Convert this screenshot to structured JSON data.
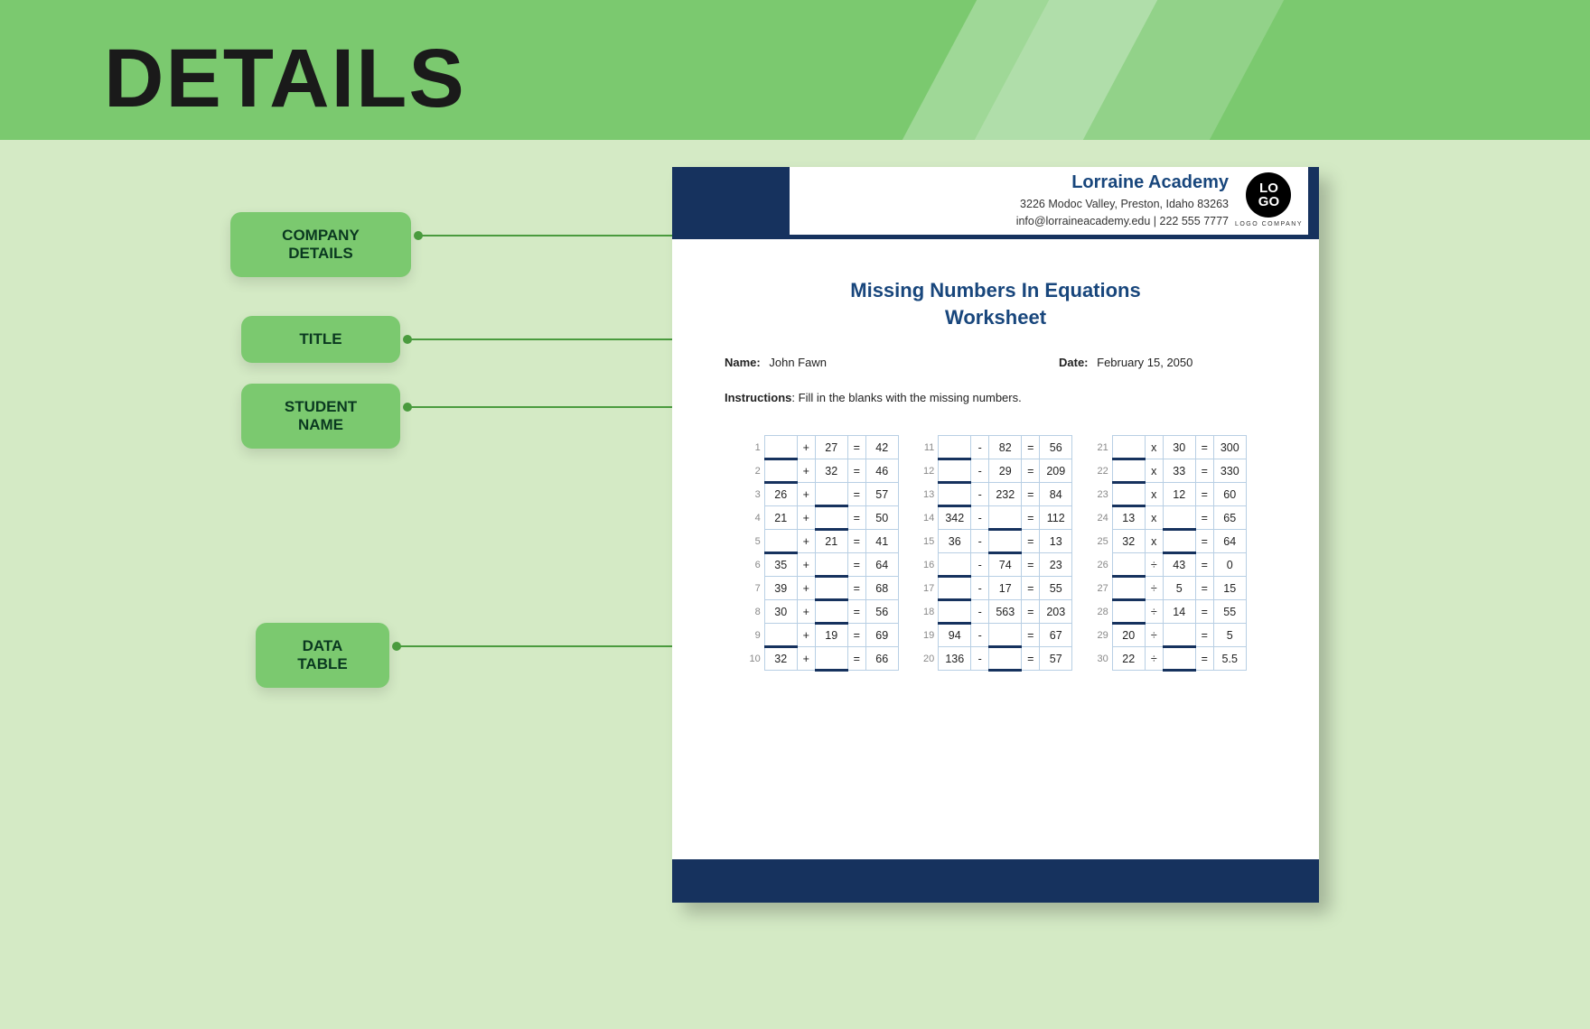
{
  "banner": {
    "title": "DETAILS"
  },
  "labels": {
    "company": "COMPANY DETAILS",
    "title": "TITLE",
    "student": "STUDENT NAME",
    "data": "DATA TABLE"
  },
  "doc": {
    "company": {
      "name": "Lorraine Academy",
      "address": "3226 Modoc Valley, Preston, Idaho 83263",
      "contact": "info@lorraineacademy.edu | 222 555 7777"
    },
    "logo": {
      "line1": "LO",
      "line2": "GO",
      "sub": "LOGO COMPANY"
    },
    "title": "Missing Numbers In Equations Worksheet",
    "meta": {
      "name_label": "Name:",
      "name_value": "John Fawn",
      "date_label": "Date:",
      "date_value": "February 15, 2050"
    },
    "instructions_label": "Instructions",
    "instructions_text": ": Fill in the blanks with the missing numbers.",
    "tables": [
      {
        "start": 1,
        "rows": [
          {
            "a": "",
            "op": "+",
            "b": "27",
            "r": "42"
          },
          {
            "a": "",
            "op": "+",
            "b": "32",
            "r": "46"
          },
          {
            "a": "26",
            "op": "+",
            "b": "",
            "r": "57"
          },
          {
            "a": "21",
            "op": "+",
            "b": "",
            "r": "50"
          },
          {
            "a": "",
            "op": "+",
            "b": "21",
            "r": "41"
          },
          {
            "a": "35",
            "op": "+",
            "b": "",
            "r": "64"
          },
          {
            "a": "39",
            "op": "+",
            "b": "",
            "r": "68"
          },
          {
            "a": "30",
            "op": "+",
            "b": "",
            "r": "56"
          },
          {
            "a": "",
            "op": "+",
            "b": "19",
            "r": "69"
          },
          {
            "a": "32",
            "op": "+",
            "b": "",
            "r": "66"
          }
        ]
      },
      {
        "start": 11,
        "rows": [
          {
            "a": "",
            "op": "-",
            "b": "82",
            "r": "56"
          },
          {
            "a": "",
            "op": "-",
            "b": "29",
            "r": "209"
          },
          {
            "a": "",
            "op": "-",
            "b": "232",
            "r": "84"
          },
          {
            "a": "342",
            "op": "-",
            "b": "",
            "r": "112"
          },
          {
            "a": "36",
            "op": "-",
            "b": "",
            "r": "13"
          },
          {
            "a": "",
            "op": "-",
            "b": "74",
            "r": "23"
          },
          {
            "a": "",
            "op": "-",
            "b": "17",
            "r": "55"
          },
          {
            "a": "",
            "op": "-",
            "b": "563",
            "r": "203"
          },
          {
            "a": "94",
            "op": "-",
            "b": "",
            "r": "67"
          },
          {
            "a": "136",
            "op": "-",
            "b": "",
            "r": "57"
          }
        ]
      },
      {
        "start": 21,
        "rows": [
          {
            "a": "",
            "op": "x",
            "b": "30",
            "r": "300"
          },
          {
            "a": "",
            "op": "x",
            "b": "33",
            "r": "330"
          },
          {
            "a": "",
            "op": "x",
            "b": "12",
            "r": "60"
          },
          {
            "a": "13",
            "op": "x",
            "b": "",
            "r": "65"
          },
          {
            "a": "32",
            "op": "x",
            "b": "",
            "r": "64"
          },
          {
            "a": "",
            "op": "÷",
            "b": "43",
            "r": "0"
          },
          {
            "a": "",
            "op": "÷",
            "b": "5",
            "r": "15"
          },
          {
            "a": "",
            "op": "÷",
            "b": "14",
            "r": "55"
          },
          {
            "a": "20",
            "op": "÷",
            "b": "",
            "r": "5"
          },
          {
            "a": "22",
            "op": "÷",
            "b": "",
            "r": "5.5"
          }
        ]
      }
    ]
  }
}
